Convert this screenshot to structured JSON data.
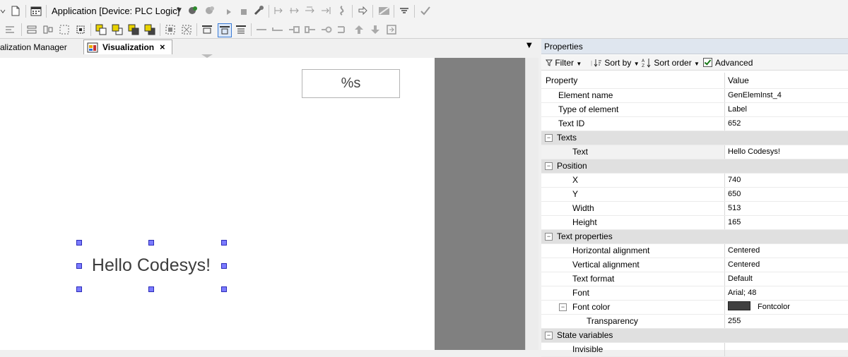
{
  "toolbar": {
    "application_combo": "Application [Device: PLC Logic]"
  },
  "tabs": [
    {
      "label": "alization Manager"
    },
    {
      "label": "Visualization",
      "close": "×"
    }
  ],
  "canvas": {
    "percent_element": "%s",
    "label_element": "Hello Codesys!"
  },
  "properties": {
    "title": "Properties",
    "toolbar": {
      "filter": "Filter",
      "sort_by": "Sort by",
      "sort_order": "Sort order",
      "advanced": "Advanced"
    },
    "columns": {
      "property": "Property",
      "value": "Value"
    },
    "rows": [
      {
        "name": "Element name",
        "value": "GenElemInst_4"
      },
      {
        "name": "Type of element",
        "value": "Label"
      },
      {
        "name": "Text ID",
        "value": "652"
      },
      {
        "name": "Texts",
        "category": true
      },
      {
        "name": "Text",
        "value": "Hello Codesys!"
      },
      {
        "name": "Position",
        "category": true
      },
      {
        "name": "X",
        "value": "740"
      },
      {
        "name": "Y",
        "value": "650"
      },
      {
        "name": "Width",
        "value": "513"
      },
      {
        "name": "Height",
        "value": "165"
      },
      {
        "name": "Text properties",
        "category": true
      },
      {
        "name": "Horizontal alignment",
        "value": "Centered"
      },
      {
        "name": "Vertical alignment",
        "value": "Centered"
      },
      {
        "name": "Text format",
        "value": "Default"
      },
      {
        "name": "Font",
        "value": "Arial; 48"
      },
      {
        "name": "Font color",
        "value": "Fontcolor",
        "swatch_color": "#404040"
      },
      {
        "name": "Transparency",
        "value": "255"
      },
      {
        "name": "State variables",
        "category": true
      },
      {
        "name": "Invisible",
        "value": ""
      }
    ],
    "toggle_minus": "−"
  }
}
